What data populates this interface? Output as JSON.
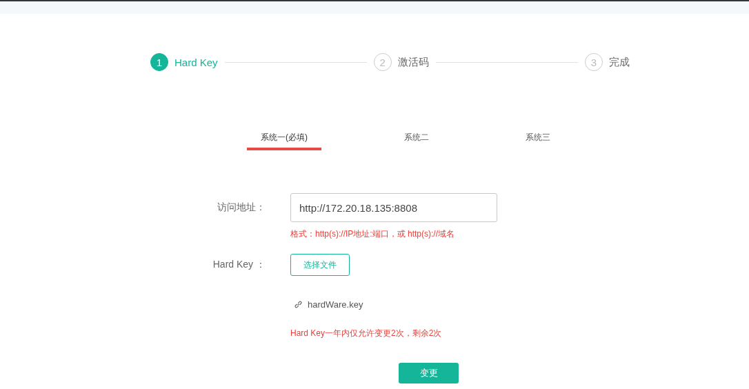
{
  "steps": [
    {
      "number": "1",
      "label": "Hard Key",
      "active": true
    },
    {
      "number": "2",
      "label": "激活码",
      "active": false
    },
    {
      "number": "3",
      "label": "完成",
      "active": false
    }
  ],
  "tabs": [
    {
      "label": "系统一(必填)",
      "selected": true
    },
    {
      "label": "系统二",
      "selected": false
    },
    {
      "label": "系统三",
      "selected": false
    }
  ],
  "form": {
    "address_label": "访问地址：",
    "address_value": "http://172.20.18.135:8808",
    "address_hint": "格式：http(s)://IP地址:端口，或 http(s)://域名",
    "hardkey_label": "Hard Key ：",
    "choose_button": "选择文件",
    "file_name": "hardWare.key",
    "limit_note": "Hard Key一年内仅允许变更2次，剩余2次"
  },
  "submit_button": "变更"
}
